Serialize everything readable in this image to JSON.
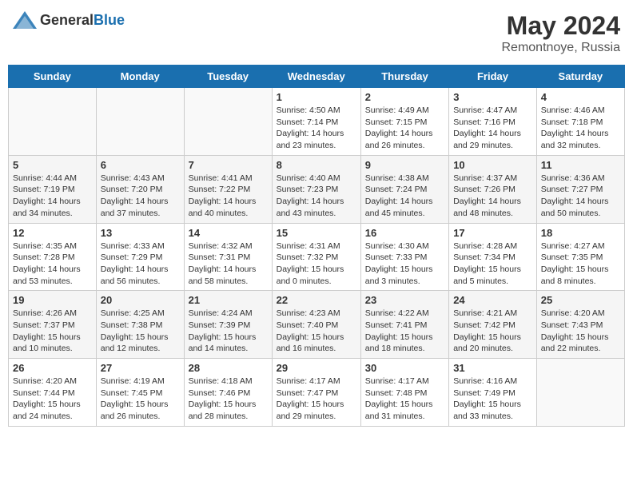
{
  "header": {
    "logo_general": "General",
    "logo_blue": "Blue",
    "title": "May 2024",
    "subtitle": "Remontnoye, Russia"
  },
  "columns": [
    "Sunday",
    "Monday",
    "Tuesday",
    "Wednesday",
    "Thursday",
    "Friday",
    "Saturday"
  ],
  "weeks": [
    [
      {
        "day": "",
        "info": ""
      },
      {
        "day": "",
        "info": ""
      },
      {
        "day": "",
        "info": ""
      },
      {
        "day": "1",
        "info": "Sunrise: 4:50 AM\nSunset: 7:14 PM\nDaylight: 14 hours\nand 23 minutes."
      },
      {
        "day": "2",
        "info": "Sunrise: 4:49 AM\nSunset: 7:15 PM\nDaylight: 14 hours\nand 26 minutes."
      },
      {
        "day": "3",
        "info": "Sunrise: 4:47 AM\nSunset: 7:16 PM\nDaylight: 14 hours\nand 29 minutes."
      },
      {
        "day": "4",
        "info": "Sunrise: 4:46 AM\nSunset: 7:18 PM\nDaylight: 14 hours\nand 32 minutes."
      }
    ],
    [
      {
        "day": "5",
        "info": "Sunrise: 4:44 AM\nSunset: 7:19 PM\nDaylight: 14 hours\nand 34 minutes."
      },
      {
        "day": "6",
        "info": "Sunrise: 4:43 AM\nSunset: 7:20 PM\nDaylight: 14 hours\nand 37 minutes."
      },
      {
        "day": "7",
        "info": "Sunrise: 4:41 AM\nSunset: 7:22 PM\nDaylight: 14 hours\nand 40 minutes."
      },
      {
        "day": "8",
        "info": "Sunrise: 4:40 AM\nSunset: 7:23 PM\nDaylight: 14 hours\nand 43 minutes."
      },
      {
        "day": "9",
        "info": "Sunrise: 4:38 AM\nSunset: 7:24 PM\nDaylight: 14 hours\nand 45 minutes."
      },
      {
        "day": "10",
        "info": "Sunrise: 4:37 AM\nSunset: 7:26 PM\nDaylight: 14 hours\nand 48 minutes."
      },
      {
        "day": "11",
        "info": "Sunrise: 4:36 AM\nSunset: 7:27 PM\nDaylight: 14 hours\nand 50 minutes."
      }
    ],
    [
      {
        "day": "12",
        "info": "Sunrise: 4:35 AM\nSunset: 7:28 PM\nDaylight: 14 hours\nand 53 minutes."
      },
      {
        "day": "13",
        "info": "Sunrise: 4:33 AM\nSunset: 7:29 PM\nDaylight: 14 hours\nand 56 minutes."
      },
      {
        "day": "14",
        "info": "Sunrise: 4:32 AM\nSunset: 7:31 PM\nDaylight: 14 hours\nand 58 minutes."
      },
      {
        "day": "15",
        "info": "Sunrise: 4:31 AM\nSunset: 7:32 PM\nDaylight: 15 hours\nand 0 minutes."
      },
      {
        "day": "16",
        "info": "Sunrise: 4:30 AM\nSunset: 7:33 PM\nDaylight: 15 hours\nand 3 minutes."
      },
      {
        "day": "17",
        "info": "Sunrise: 4:28 AM\nSunset: 7:34 PM\nDaylight: 15 hours\nand 5 minutes."
      },
      {
        "day": "18",
        "info": "Sunrise: 4:27 AM\nSunset: 7:35 PM\nDaylight: 15 hours\nand 8 minutes."
      }
    ],
    [
      {
        "day": "19",
        "info": "Sunrise: 4:26 AM\nSunset: 7:37 PM\nDaylight: 15 hours\nand 10 minutes."
      },
      {
        "day": "20",
        "info": "Sunrise: 4:25 AM\nSunset: 7:38 PM\nDaylight: 15 hours\nand 12 minutes."
      },
      {
        "day": "21",
        "info": "Sunrise: 4:24 AM\nSunset: 7:39 PM\nDaylight: 15 hours\nand 14 minutes."
      },
      {
        "day": "22",
        "info": "Sunrise: 4:23 AM\nSunset: 7:40 PM\nDaylight: 15 hours\nand 16 minutes."
      },
      {
        "day": "23",
        "info": "Sunrise: 4:22 AM\nSunset: 7:41 PM\nDaylight: 15 hours\nand 18 minutes."
      },
      {
        "day": "24",
        "info": "Sunrise: 4:21 AM\nSunset: 7:42 PM\nDaylight: 15 hours\nand 20 minutes."
      },
      {
        "day": "25",
        "info": "Sunrise: 4:20 AM\nSunset: 7:43 PM\nDaylight: 15 hours\nand 22 minutes."
      }
    ],
    [
      {
        "day": "26",
        "info": "Sunrise: 4:20 AM\nSunset: 7:44 PM\nDaylight: 15 hours\nand 24 minutes."
      },
      {
        "day": "27",
        "info": "Sunrise: 4:19 AM\nSunset: 7:45 PM\nDaylight: 15 hours\nand 26 minutes."
      },
      {
        "day": "28",
        "info": "Sunrise: 4:18 AM\nSunset: 7:46 PM\nDaylight: 15 hours\nand 28 minutes."
      },
      {
        "day": "29",
        "info": "Sunrise: 4:17 AM\nSunset: 7:47 PM\nDaylight: 15 hours\nand 29 minutes."
      },
      {
        "day": "30",
        "info": "Sunrise: 4:17 AM\nSunset: 7:48 PM\nDaylight: 15 hours\nand 31 minutes."
      },
      {
        "day": "31",
        "info": "Sunrise: 4:16 AM\nSunset: 7:49 PM\nDaylight: 15 hours\nand 33 minutes."
      },
      {
        "day": "",
        "info": ""
      }
    ]
  ]
}
